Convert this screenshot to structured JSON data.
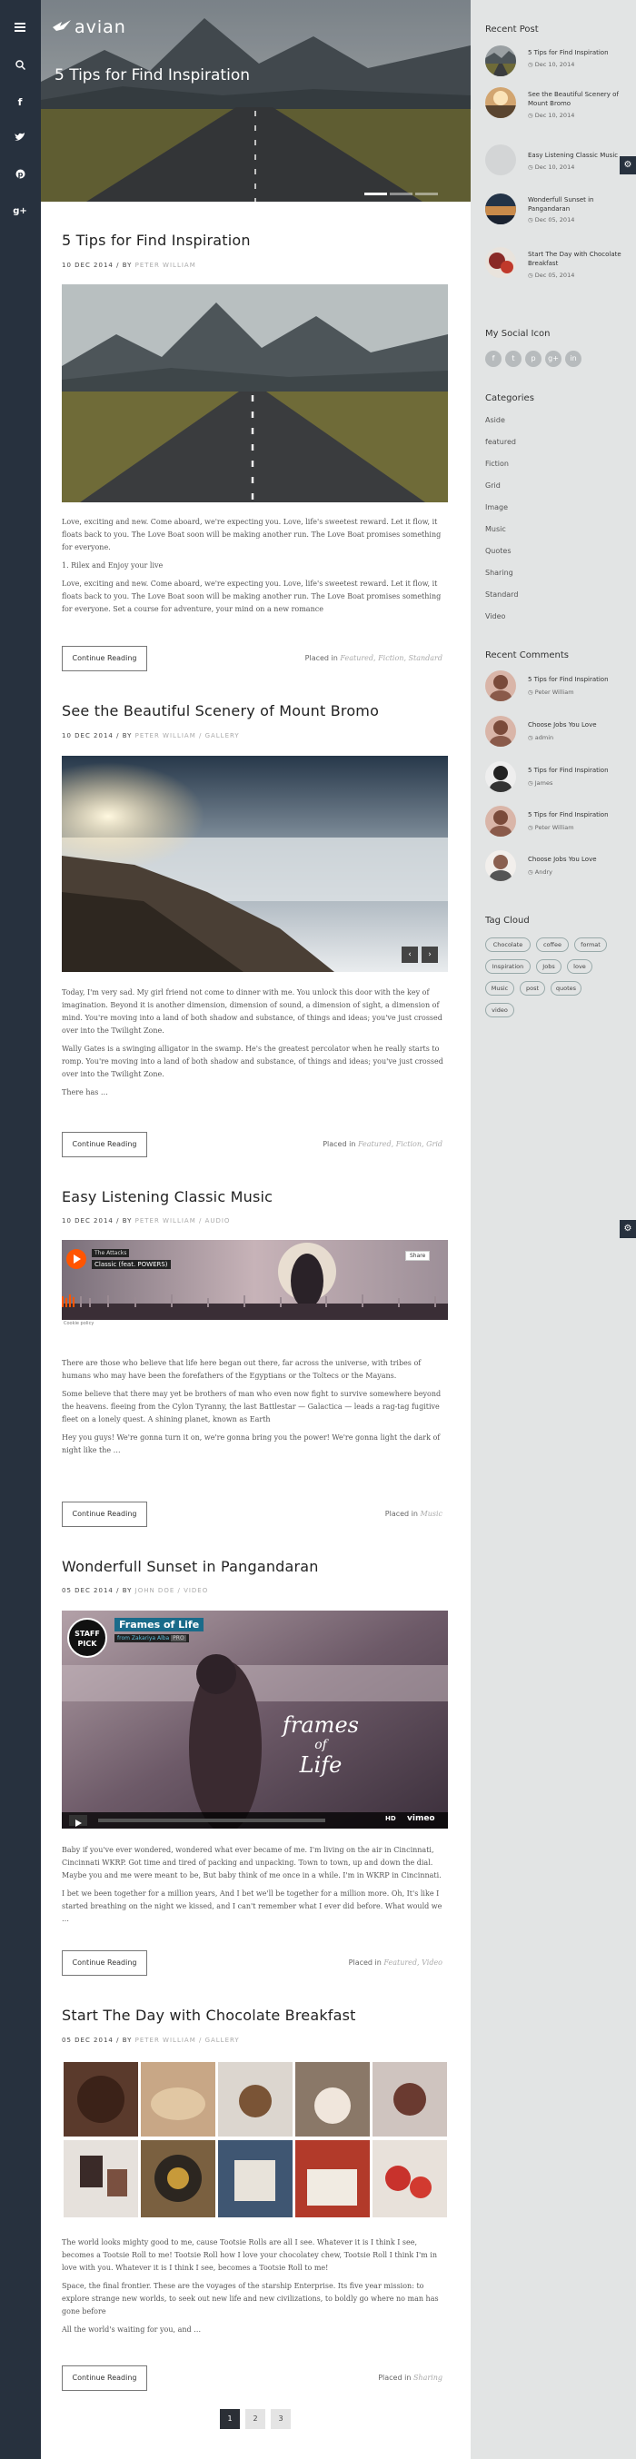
{
  "brand": {
    "name": "avian"
  },
  "hero": {
    "title": "5 Tips for Find Inspiration"
  },
  "left_nav": [
    "menu-icon",
    "search-icon",
    "facebook-icon",
    "twitter-icon",
    "pinterest-icon",
    "google-plus-icon"
  ],
  "posts": [
    {
      "title": "5 Tips for Find Inspiration",
      "date": "10 DEC 2014",
      "by": "/ BY",
      "author": "PETER WILLIAM",
      "format": "",
      "paragraphs": [
        "Love, exciting and new. Come aboard, we're expecting you. Love, life's sweetest reward. Let it flow, it floats back to you. The Love Boat soon will be making another run. The Love Boat promises something for everyone.",
        "1. Rilex and Enjoy your live",
        "Love, exciting and new. Come aboard, we're expecting you. Love, life's sweetest reward. Let it flow, it floats back to you. The Love Boat soon will be making another run. The Love Boat promises something for everyone. Set a course for adventure, your mind on a new romance"
      ],
      "button": "Continue Reading",
      "placed_label": "Placed in",
      "categories": "Featured, Fiction, Standard"
    },
    {
      "title": "See the Beautiful Scenery of Mount Bromo",
      "date": "10 DEC 2014",
      "by": "/ BY",
      "author": "PETER WILLIAM",
      "format": "/ GALLERY",
      "paragraphs": [
        "Today, I'm very sad. My girl friend not come to dinner with me. You unlock this door with the key of imagination. Beyond it is another dimension, dimension of sound, a dimension of sight, a dimension of mind. You're moving into a land of both shadow and substance, of things and ideas; you've just crossed over into the Twilight Zone.",
        "Wally Gates is a swinging alligator in the swamp. He's the greatest percolator when he really starts to romp. You're moving into a land of both shadow and substance, of things and ideas; you've just crossed over into the Twilight Zone.",
        "There has …"
      ],
      "button": "Continue Reading",
      "placed_label": "Placed in",
      "categories": "Featured, Fiction, Grid"
    },
    {
      "title": "Easy Listening Classic Music",
      "date": "10 DEC 2014",
      "by": "/ BY",
      "author": "PETER WILLIAM",
      "format": "/ AUDIO",
      "paragraphs": [
        "There are those who believe that life here began out there, far across the universe, with tribes of humans who may have been the forefathers of the Egyptians or the Toltecs or the Mayans.",
        "Some believe that there may yet be brothers of man who even now fight to survive somewhere beyond the heavens. fleeing from the Cylon Tyranny, the last Battlestar — Galactica — leads a rag-tag fugitive fleet on a lonely quest. A shining planet, known as Earth",
        "Hey you guys! We're gonna turn it on, we're gonna bring you the power! We're gonna light the dark of night like the …"
      ],
      "button": "Continue Reading",
      "placed_label": "Placed in",
      "categories": "Music"
    },
    {
      "title": "Wonderfull Sunset in Pangandaran",
      "date": "05 DEC 2014",
      "by": "/ BY",
      "author": "JOHN DOE",
      "format": "/ VIDEO",
      "paragraphs": [
        "Baby if you've ever wondered, wondered what ever became of me. I'm living on the air in Cincinnati, Cincinnati WKRP. Got time and tired of packing and unpacking. Town to town, up and down the dial. Maybe you and me were meant to be, But baby think of me once in a while. I'm in WKRP in Cincinnati.",
        "I bet we been together for a million years, And I bet we'll be together for a million more. Oh, It's like I started breathing on the night we kissed, and I can't remember what I ever did before. What would we …"
      ],
      "button": "Continue Reading",
      "placed_label": "Placed in",
      "categories": "Featured, Video"
    },
    {
      "title": "Start The Day with Chocolate Breakfast",
      "date": "05 DEC 2014",
      "by": "/ BY",
      "author": "PETER WILLIAM",
      "format": "/ GALLERY",
      "paragraphs": [
        "The world looks mighty good to me, cause Tootsie Rolls are all I see. Whatever it is I think I see, becomes a Tootsie Roll to me! Tootsie Roll how I love your chocolatey chew, Tootsie Roll I think I'm in love with you. Whatever it is I think I see, becomes a Tootsie Roll to me!",
        "Space, the final frontier. These are the voyages of the starship Enterprise. Its five year mission: to explore strange new worlds, to seek out new life and new civilizations, to boldly go where no man has gone before",
        "All the world's waiting for you, and …"
      ],
      "button": "Continue Reading",
      "placed_label": "Placed in",
      "categories": "Sharing"
    }
  ],
  "audio": {
    "artist": "The Attacks",
    "track": "Classic (feat. POWERS)",
    "share": "Share",
    "footer": "Cookie policy"
  },
  "video": {
    "badge_line1": "STAFF",
    "badge_line2": "PICK",
    "title": "Frames of Life",
    "from": "from Zakariya Alba",
    "plus": "PRO",
    "overlay_line1": "frames",
    "overlay_line2": "of",
    "overlay_line3": "Life",
    "hd": "HD",
    "vimeo": "vimeo"
  },
  "pagination": [
    "1",
    "2",
    "3"
  ],
  "sidebar": {
    "recent_post_title": "Recent Post",
    "recent_posts": [
      {
        "title": "5 Tips for Find Inspiration",
        "date": "Dec 10, 2014"
      },
      {
        "title": "See the Beautiful Scenery of Mount Bromo",
        "date": "Dec 10, 2014"
      },
      {
        "title": "Easy Listening Classic Music",
        "date": "Dec 10, 2014"
      },
      {
        "title": "Wonderfull Sunset in Pangandaran",
        "date": "Dec 05, 2014"
      },
      {
        "title": "Start The Day with Chocolate Breakfast",
        "date": "Dec 05, 2014"
      }
    ],
    "social_title": "My Social Icon",
    "social_icons": [
      "f",
      "t",
      "p",
      "g+",
      "in"
    ],
    "categories_title": "Categories",
    "categories": [
      "Aside",
      "featured",
      "Fiction",
      "Grid",
      "Image",
      "Music",
      "Quotes",
      "Sharing",
      "Standard",
      "Video"
    ],
    "recent_comments_title": "Recent Comments",
    "recent_comments": [
      {
        "post": "5 Tips for Find Inspiration",
        "author": "Peter William"
      },
      {
        "post": "Choose Jobs You Love",
        "author": "admin"
      },
      {
        "post": "5 Tips for Find Inspiration",
        "author": "James"
      },
      {
        "post": "5 Tips for Find Inspiration",
        "author": "Peter William"
      },
      {
        "post": "Choose Jobs You Love",
        "author": "Andry"
      }
    ],
    "tag_cloud_title": "Tag Cloud",
    "tags": [
      "Chocolate",
      "coffee",
      "format",
      "Inspiration",
      "Jobs",
      "love",
      "Music",
      "post",
      "quotes",
      "video"
    ]
  },
  "colors": {
    "sidebar_dark": "#27313e",
    "accent_category": "#aaaaaa"
  }
}
